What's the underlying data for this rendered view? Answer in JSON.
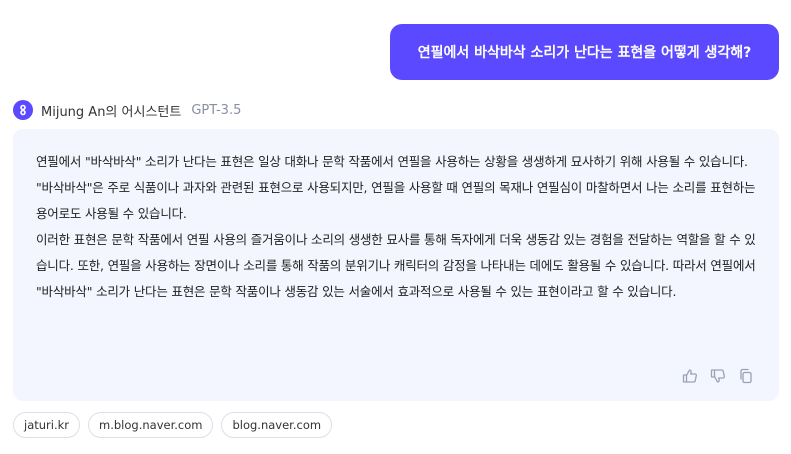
{
  "user_message": "연필에서 바삭바삭 소리가 난다는 표현을 어떻게 생각해?",
  "assistant": {
    "name": "Mijung An의 어시스턴트",
    "model": "GPT-3.5",
    "avatar_icon": "link-icon",
    "answer_paragraphs": [
      "연필에서 \"바삭바삭\" 소리가 난다는 표현은 일상 대화나 문학 작품에서 연필을 사용하는 상황을 생생하게 묘사하기 위해 사용될 수 있습니다. \"바삭바삭\"은 주로 식품이나 과자와 관련된 표현으로 사용되지만, 연필을 사용할 때 연필의 목재나 연필심이 마찰하면서 나는 소리를 표현하는 용어로도 사용될 수 있습니다.",
      "이러한 표현은 문학 작품에서 연필 사용의 즐거움이나 소리의 생생한 묘사를 통해 독자에게 더욱 생동감 있는 경험을 전달하는 역할을 할 수 있습니다. 또한, 연필을 사용하는 장면이나 소리를 통해 작품의 분위기나 캐릭터의 감정을 나타내는 데에도 활용될 수 있습니다. 따라서 연필에서 \"바삭바삭\" 소리가 난다는 표현은 문학 작품이나 생동감 있는 서술에서 효과적으로 사용될 수 있는 표현이라고 할 수 있습니다."
    ],
    "feedback_icons": [
      "thumbs-up-icon",
      "thumbs-down-icon",
      "copy-icon"
    ]
  },
  "sources": [
    "jaturi.kr",
    "m.blog.naver.com",
    "blog.naver.com"
  ],
  "colors": {
    "accent": "#5b49ff",
    "card_background": "#f3f6ff",
    "model_tag": "#8a8fa3"
  }
}
